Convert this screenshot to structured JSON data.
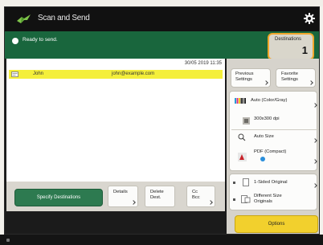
{
  "app": {
    "title": "Scan and Send"
  },
  "status": {
    "text": "Ready to send."
  },
  "destinations_counter": {
    "label": "Destinations",
    "count": "1"
  },
  "list": {
    "timestamp": "30/05 2019 11:35",
    "rows": [
      {
        "name": "John",
        "address": "john@example.com"
      }
    ]
  },
  "left_toolbar": {
    "specify_label": "Specify Destinations",
    "details_label": "Details",
    "delete_label_1": "Delete",
    "delete_label_2": "Dest.",
    "cc_label_1": "Cc",
    "cc_label_2": "Bcc"
  },
  "right_panel": {
    "previous_1": "Previous",
    "previous_2": "Settings",
    "favorite_1": "Favorite",
    "favorite_2": "Settings",
    "color_mode": "Auto (Color/Gray)",
    "resolution": "300x300 dpi",
    "size": "Auto Size",
    "format_1": "PDF (Compact)",
    "sides": "1-Sided Original",
    "diff_size_1": "Different Size",
    "diff_size_2": "Originals",
    "options": "Options"
  },
  "colors": {
    "status_green": "#19663d",
    "selected_row": "#f4ef3a",
    "options_yellow": "#f2d02d",
    "highlight_orange": "#f0a62b"
  },
  "icons": [
    "scan-send-icon",
    "settings-gear-icon",
    "status-ok-icon",
    "contact-card-icon",
    "color-mode-icon",
    "resolution-icon",
    "size-icon",
    "pdf-file-icon",
    "one-sided-icon",
    "different-size-icon"
  ]
}
